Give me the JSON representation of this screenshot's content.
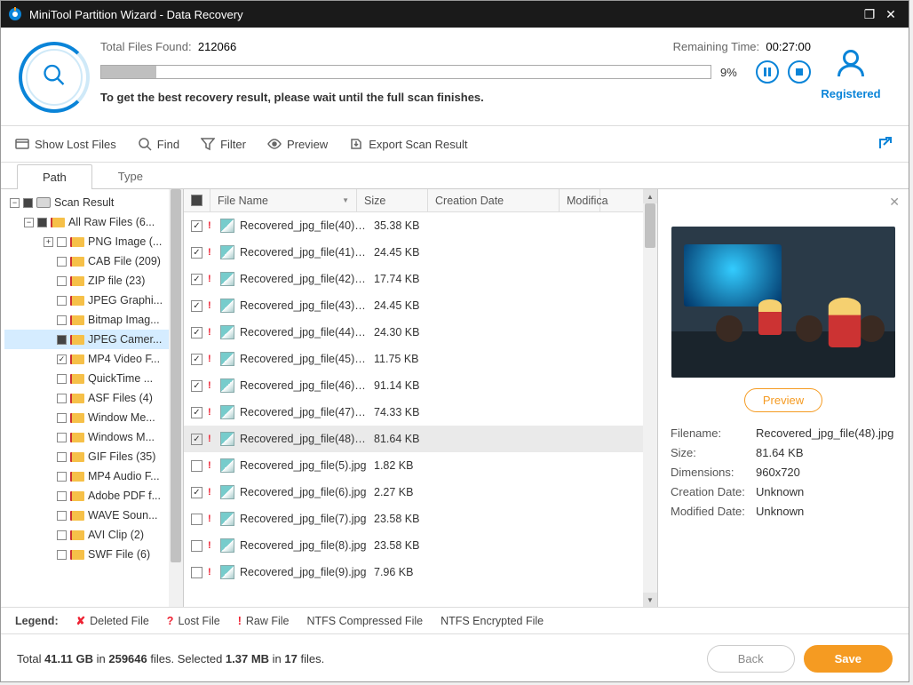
{
  "title": "MiniTool Partition Wizard - Data Recovery",
  "scan": {
    "found_label": "Total Files Found:",
    "found_value": "212066",
    "remain_label": "Remaining Time:",
    "remain_value": "00:27:00",
    "percent": "9%",
    "tip": "To get the best recovery result, please wait until the full scan finishes.",
    "registered": "Registered"
  },
  "toolbar": {
    "show_lost": "Show Lost Files",
    "find": "Find",
    "filter": "Filter",
    "preview": "Preview",
    "export": "Export Scan Result"
  },
  "tabs": {
    "path": "Path",
    "type": "Type"
  },
  "tree": {
    "root": "Scan Result",
    "all_raw": "All Raw Files (6...",
    "items": [
      "PNG Image (...",
      "CAB File (209)",
      "ZIP file (23)",
      "JPEG Graphi...",
      "Bitmap Imag...",
      "JPEG Camer...",
      "MP4 Video F...",
      "QuickTime ...",
      "ASF Files (4)",
      "Window Me...",
      "Windows M...",
      "GIF Files (35)",
      "MP4 Audio F...",
      "Adobe PDF f...",
      "WAVE Soun...",
      "AVI Clip (2)",
      "SWF File (6)"
    ]
  },
  "columns": {
    "name": "File Name",
    "size": "Size",
    "cd": "Creation Date",
    "md": "Modifica"
  },
  "files": [
    {
      "checked": true,
      "name": "Recovered_jpg_file(40).j...",
      "size": "35.38 KB"
    },
    {
      "checked": true,
      "name": "Recovered_jpg_file(41).j...",
      "size": "24.45 KB"
    },
    {
      "checked": true,
      "name": "Recovered_jpg_file(42).j...",
      "size": "17.74 KB"
    },
    {
      "checked": true,
      "name": "Recovered_jpg_file(43).j...",
      "size": "24.45 KB"
    },
    {
      "checked": true,
      "name": "Recovered_jpg_file(44).j...",
      "size": "24.30 KB"
    },
    {
      "checked": true,
      "name": "Recovered_jpg_file(45).j...",
      "size": "11.75 KB"
    },
    {
      "checked": true,
      "name": "Recovered_jpg_file(46).j...",
      "size": "91.14 KB"
    },
    {
      "checked": true,
      "name": "Recovered_jpg_file(47).j...",
      "size": "74.33 KB"
    },
    {
      "checked": true,
      "name": "Recovered_jpg_file(48).j...",
      "size": "81.64 KB",
      "selected": true
    },
    {
      "checked": false,
      "name": "Recovered_jpg_file(5).jpg",
      "size": "1.82 KB"
    },
    {
      "checked": true,
      "name": "Recovered_jpg_file(6).jpg",
      "size": "2.27 KB"
    },
    {
      "checked": false,
      "name": "Recovered_jpg_file(7).jpg",
      "size": "23.58 KB"
    },
    {
      "checked": false,
      "name": "Recovered_jpg_file(8).jpg",
      "size": "23.58 KB"
    },
    {
      "checked": false,
      "name": "Recovered_jpg_file(9).jpg",
      "size": "7.96 KB"
    }
  ],
  "preview": {
    "button": "Preview",
    "filename_label": "Filename:",
    "filename": "Recovered_jpg_file(48).jpg",
    "size_label": "Size:",
    "size": "81.64 KB",
    "dim_label": "Dimensions:",
    "dim": "960x720",
    "cd_label": "Creation Date:",
    "cd": "Unknown",
    "md_label": "Modified Date:",
    "md": "Unknown"
  },
  "legend": {
    "label": "Legend:",
    "deleted": "Deleted File",
    "lost": "Lost File",
    "raw": "Raw File",
    "ntfs_c": "NTFS Compressed File",
    "ntfs_e": "NTFS Encrypted File"
  },
  "footer": {
    "status_a": "Total ",
    "total_size": "41.11 GB",
    "status_b": " in ",
    "total_files": "259646",
    "status_c": " files.  Selected ",
    "sel_size": "1.37 MB",
    "status_d": " in ",
    "sel_files": "17",
    "status_e": " files.",
    "back": "Back",
    "save": "Save"
  }
}
